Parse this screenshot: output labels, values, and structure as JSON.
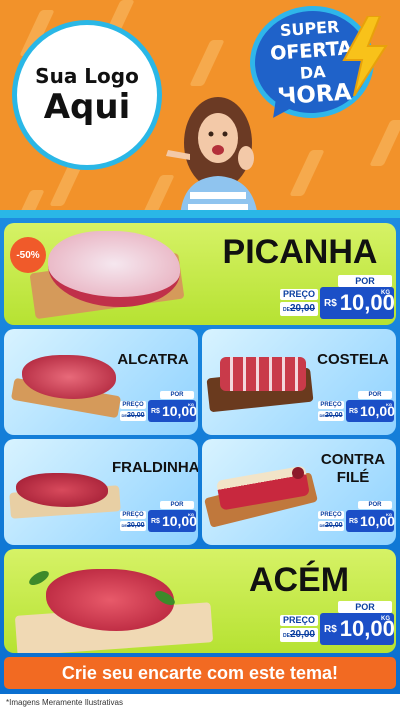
{
  "header": {
    "logo_line1": "Sua Logo",
    "logo_line2": "Aqui",
    "badge": [
      "SUPER",
      "OFERTA",
      "DA",
      "HORA"
    ]
  },
  "products": [
    {
      "name": "PICANHA",
      "discount": "-50%",
      "por": "POR",
      "label": "PREÇO",
      "old_prefix": "DE",
      "old_value": "20,00",
      "currency": "R$",
      "value": "10,00",
      "unit": "KG"
    },
    {
      "name": "ALCATRA",
      "por": "POR",
      "label": "PREÇO",
      "old_prefix": "DE",
      "old_value": "20,00",
      "currency": "R$",
      "value": "10,00",
      "unit": "KG"
    },
    {
      "name": "COSTELA",
      "por": "POR",
      "label": "PREÇO",
      "old_prefix": "DE",
      "old_value": "20,00",
      "currency": "R$",
      "value": "10,00",
      "unit": "KG"
    },
    {
      "name": "FRALDINHA",
      "por": "POR",
      "label": "PREÇO",
      "old_prefix": "DE",
      "old_value": "20,00",
      "currency": "R$",
      "value": "10,00",
      "unit": "KG"
    },
    {
      "name_line1": "CONTRA",
      "name_line2": "FILÉ",
      "por": "POR",
      "label": "PREÇO",
      "old_prefix": "DE",
      "old_value": "20,00",
      "currency": "R$",
      "value": "10,00",
      "unit": "KG"
    },
    {
      "name": "ACÉM",
      "por": "POR",
      "label": "PREÇO",
      "old_prefix": "DE",
      "old_value": "20,00",
      "currency": "R$",
      "value": "10,00",
      "unit": "KG"
    }
  ],
  "cta": "Crie seu encarte com este tema!",
  "footer": "*Imagens Meramente Ilustrativas",
  "colors": {
    "header": "#f2922a",
    "accent_blue": "#1b4fc7",
    "green_card": "#c7ea44",
    "orange_cta": "#f26a22"
  }
}
